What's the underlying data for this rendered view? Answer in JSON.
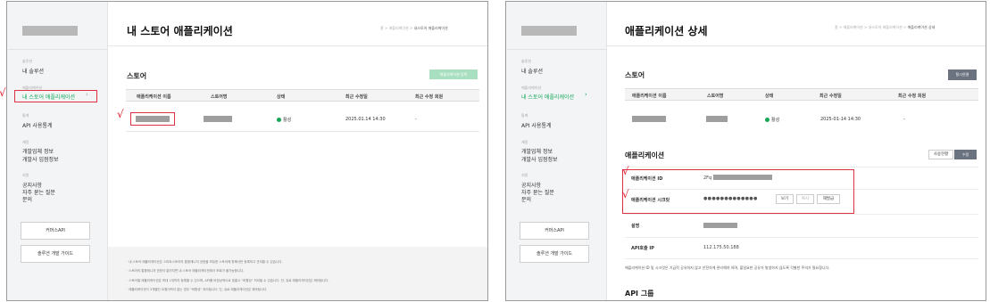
{
  "left": {
    "sidebar": {
      "groups": [
        {
          "caption": "솔루션",
          "items": [
            "내 솔루션"
          ]
        },
        {
          "caption": "애플리케이션",
          "items": [
            "내 스토어 애플리케이션"
          ]
        },
        {
          "caption": "통계",
          "items": [
            "API 사용통계"
          ]
        },
        {
          "caption": "계정",
          "items": [
            "개발업체 정보",
            "개발사 입점정보"
          ]
        },
        {
          "caption": "지원",
          "items": [
            "공지사항",
            "자주 묻는 질문",
            "문의"
          ]
        }
      ],
      "buttons": [
        "커머스API",
        "솔루션 개발 가이드"
      ]
    },
    "title": "내 스토어 애플리케이션",
    "breadcrumb": {
      "home": "홈",
      "sep": ">",
      "parent": "애플리케이션",
      "current": "내스토어 애플리케이션"
    },
    "section_title": "스토어",
    "register_button": "애플리케이션 등록",
    "table": {
      "headers": [
        "애플리케이션 이름",
        "스토어명",
        "상태",
        "최근 수정일",
        "최근 수정 회원"
      ],
      "row": {
        "status": "활성",
        "modified": "2025.01.14 14:30",
        "member": "-"
      }
    },
    "notes": [
      "· 내 스토어 애플리케이션은 스마트스토어의 통합매니저 권한을 보유한 스토어에 한해서만 등록하고 관리할 수 있습니다.",
      "· 스토어의 통합매니저 권한이 없어지면 내 스토어 애플리케이션에서 조회가 불가능합니다.",
      "· 스토어별 애플리케이션은 최대 1개까지 등록할 수 있으며, API를 비정상적으로 호출시 \"비활성\" 처리될 수 있습니다. 단, 유료 애플리케이션은 제외됩니다.",
      "· 애플리케이션이 3개월간 요청이력이 없는 경우 \"비활성\" 처리됩니다. 단, 유료 애플리케이션은 제외됩니다."
    ],
    "check_mark": "√"
  },
  "right": {
    "title": "애플리케이션 상세",
    "breadcrumb": {
      "home": "홈",
      "sep": ">",
      "p1": "애플리케이션",
      "p2": "내스토어 애플리케이션",
      "current": "애플리케이션 상세"
    },
    "store_section": "스토어",
    "unlink_button": "탈시연결",
    "table": {
      "headers": [
        "애플리케이션 이름",
        "스토어명",
        "상태",
        "최근 수정일",
        "최근 수정 회원"
      ],
      "row": {
        "status": "활성",
        "modified": "2025-01-14 14:30",
        "member": "-"
      }
    },
    "app_section": "애플리케이션",
    "usage_button": "사용현황",
    "edit_button": "수정",
    "fields": {
      "id_label": "애플리케이션 ID",
      "id_value": "2Fq",
      "secret_label": "애플리케이션 시크릿",
      "secret_value": "●●●●●●●●●●●●●",
      "view_button": "보기",
      "copy_button": "복사",
      "reissue_button": "재발급",
      "desc_label": "설명",
      "ip_label": "API호출 IP",
      "ip_value": "112.175.50.188"
    },
    "warning": "애플리케이션 ID 및 시크릿은 기급적 공유하지 않고 안전하게 관리해야 하며, 불일요한 공유가 발생하지 않도록 각별한 주의가 필요합니다.",
    "api_group": "API 그룹",
    "check_mark": "√"
  },
  "colors": {
    "accent_green": "#11a85a",
    "highlight_red": "#e03044",
    "check_red": "#e0202e"
  }
}
